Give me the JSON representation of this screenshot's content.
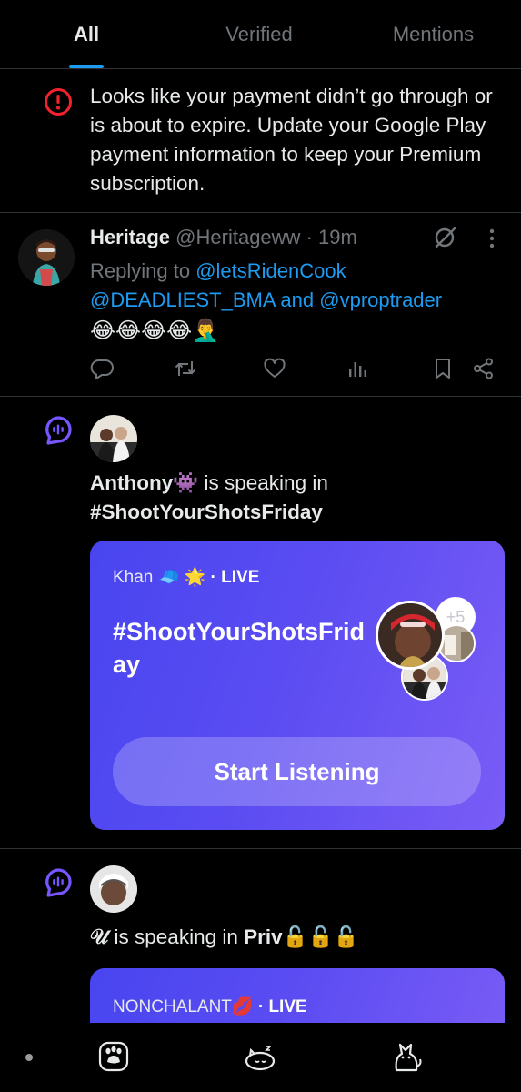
{
  "tabs": [
    {
      "label": "All",
      "active": true
    },
    {
      "label": "Verified",
      "active": false
    },
    {
      "label": "Mentions",
      "active": false
    }
  ],
  "notice": {
    "icon": "alert-circle-icon",
    "accent": "#f4212e",
    "text": "Looks like your payment didn’t go through or is about to expire. Update your Google Play payment information to keep your Premium subscription."
  },
  "post": {
    "name": "Heritage",
    "handle": "@Heritageww",
    "separator": "·",
    "time": "19m",
    "replying_prefix": "Replying to",
    "mention1": "@letsRidenCook",
    "mention2": "@DEADLIEST_BMA",
    "and": "and",
    "mention3": "@vproptrader",
    "body": "😂😂😂😂🤦‍♂️",
    "actions": [
      "reply-icon",
      "retweet-icon",
      "like-icon",
      "views-icon",
      "bookmark-icon",
      "share-icon"
    ]
  },
  "space1": {
    "speaker": "Anthony👾",
    "speaking_text": "is speaking in",
    "hashtag": "#ShootYourShotsFriday",
    "card": {
      "host": "Khan 🧢 🌟",
      "live": "· LIVE",
      "title": "#ShootYourShotsFriday",
      "more_count": "+5",
      "button": "Start Listening"
    }
  },
  "space2": {
    "speaker": "𝒰",
    "speaking_text": "is speaking in",
    "room": "Priv🔓🔓🔓",
    "card": {
      "host": "NONCHALANT💋",
      "live": "· LIVE"
    }
  },
  "colors": {
    "link": "#1d9bf0",
    "muted": "#71767b",
    "space_purple": "#7856ff",
    "card_gradient_start": "#4845f0",
    "card_gradient_end": "#7a5cf6"
  },
  "nav": [
    "paw-icon",
    "sleeping-cat-icon",
    "cat-icon"
  ]
}
